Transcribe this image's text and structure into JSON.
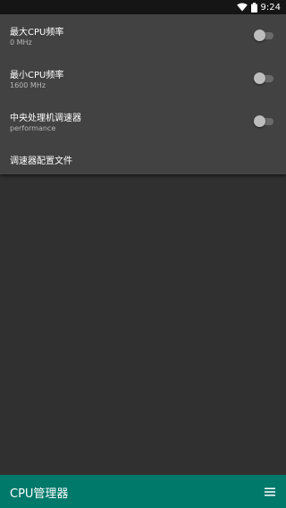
{
  "status_bar": {
    "time": "9:24",
    "icons": [
      "wifi-icon",
      "battery-icon"
    ]
  },
  "settings": [
    {
      "title": "最大CPU频率",
      "value": "0 MHz",
      "toggle": false
    },
    {
      "title": "最小CPU频率",
      "value": "1600 MHz",
      "toggle": false
    },
    {
      "title": "中央处理机调速器",
      "value": "performance",
      "toggle": false
    },
    {
      "title": "调速器配置文件"
    }
  ],
  "bottom_bar": {
    "title": "CPU管理器",
    "menu_icon": "hamburger-menu-icon",
    "color": "#00796b"
  },
  "colors": {
    "background": "#303030",
    "panel": "#424242",
    "status_bar": "#151515"
  }
}
